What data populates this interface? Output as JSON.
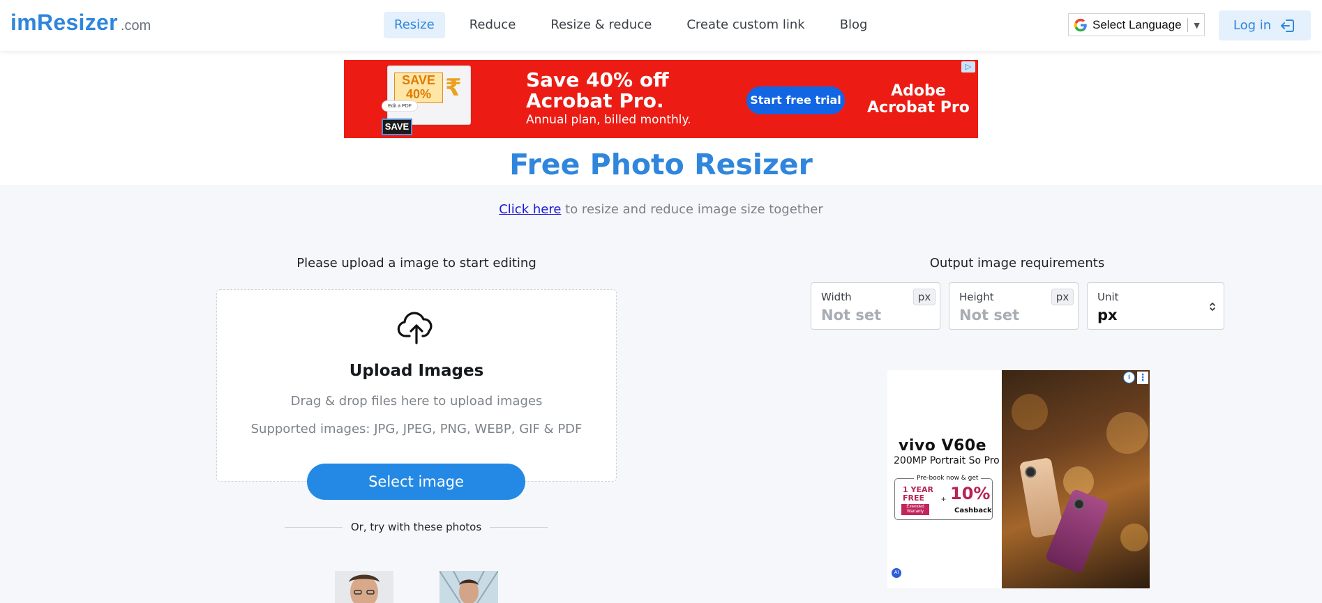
{
  "nav": {
    "logo_brand": "imResizer",
    "logo_tld": ".com",
    "links": [
      "Resize",
      "Reduce",
      "Resize & reduce",
      "Create custom link",
      "Blog"
    ],
    "active": "Resize",
    "language_label": "Select Language",
    "login_label": "Log in"
  },
  "ad_top": {
    "save_badge": "SAVE 40%",
    "edit_pdf": "Edit a PDF",
    "save_small": "SAVE",
    "headline_1": "Save 40% off",
    "headline_2": "Acrobat Pro.",
    "subtext": "Annual plan, billed monthly.",
    "cta": "Start free trial",
    "brand_1": "Adobe",
    "brand_2": "Acrobat Pro"
  },
  "page": {
    "title": "Free Photo Resizer",
    "click_link": "Click here",
    "click_rest": " to resize and reduce image size together"
  },
  "upload": {
    "heading": "Please upload a image to start editing",
    "title": "Upload Images",
    "drag_text": "Drag & drop files here to upload images",
    "supported": "Supported images: JPG, JPEG, PNG, WEBP, GIF & PDF",
    "select_button": "Select image",
    "or_text": "Or, try with these photos"
  },
  "output": {
    "heading": "Output image requirements",
    "width": {
      "label": "Width",
      "value": "Not set",
      "unit": "px"
    },
    "height": {
      "label": "Height",
      "value": "Not set",
      "unit": "px"
    },
    "unit": {
      "label": "Unit",
      "value": "px"
    }
  },
  "ad_right": {
    "brand": "vivo V60e",
    "tagline": "200MP Portrait So Pro",
    "prebook": "Pre-book now & get",
    "free_1": "1 YEAR",
    "free_2": "FREE",
    "extended": "Extended Warranty",
    "plus": "+",
    "percent": "10%",
    "cashback": "Cashback",
    "ai": "AI"
  },
  "colors": {
    "accent": "#2f86dc",
    "button": "#2389e4",
    "ad_red": "#ec1c14",
    "bg_gray": "#f5f7fa"
  }
}
